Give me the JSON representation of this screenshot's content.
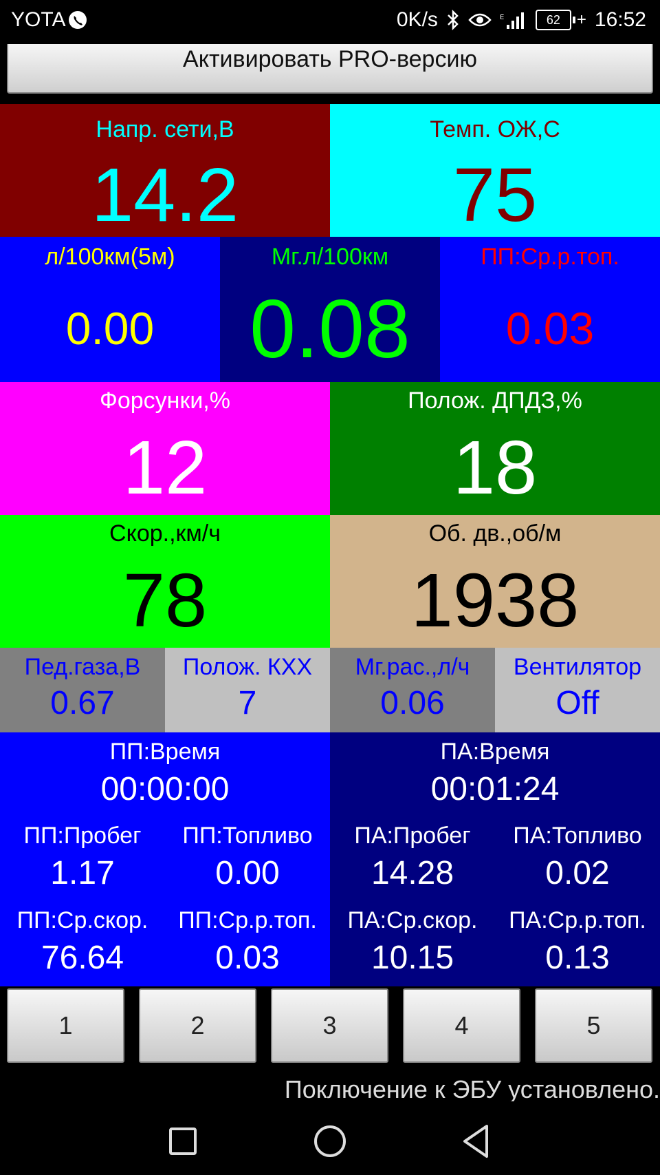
{
  "status_bar": {
    "carrier": "YOTA",
    "net_speed": "0K/s",
    "battery": "62",
    "time": "16:52"
  },
  "pro_button": "Активировать PRO-версию",
  "row1": [
    {
      "label": "Напр. сети,В",
      "value": "14.2"
    },
    {
      "label": "Темп. ОЖ,С",
      "value": "75"
    }
  ],
  "row2": [
    {
      "label": "л/100км(5м)",
      "value": "0.00"
    },
    {
      "label": "Мг.л/100км",
      "value": "0.08"
    },
    {
      "label": "ПП:Ср.р.топ.",
      "value": "0.03"
    }
  ],
  "row3": [
    {
      "label": "Форсунки,%",
      "value": "12"
    },
    {
      "label": "Полож. ДПДЗ,%",
      "value": "18"
    }
  ],
  "row4": [
    {
      "label": "Скор.,км/ч",
      "value": "78"
    },
    {
      "label": "Об. дв.,об/м",
      "value": "1938"
    }
  ],
  "row5": [
    {
      "label": "Пед.газа,В",
      "value": "0.67"
    },
    {
      "label": "Полож. КХХ",
      "value": "7"
    },
    {
      "label": "Мг.рас.,л/ч",
      "value": "0.06"
    },
    {
      "label": "Вентилятор",
      "value": "Off"
    }
  ],
  "trip_pp": {
    "time_label": "ПП:Время",
    "time_value": "00:00:00",
    "distance_label": "ПП:Пробег",
    "distance_value": "1.17",
    "fuel_label": "ПП:Топливо",
    "fuel_value": "0.00",
    "avg_speed_label": "ПП:Ср.скор.",
    "avg_speed_value": "76.64",
    "avg_fuel_label": "ПП:Ср.р.топ.",
    "avg_fuel_value": "0.03"
  },
  "trip_pa": {
    "time_label": "ПА:Время",
    "time_value": "00:01:24",
    "distance_label": "ПА:Пробег",
    "distance_value": "14.28",
    "fuel_label": "ПА:Топливо",
    "fuel_value": "0.02",
    "avg_speed_label": "ПА:Ср.скор.",
    "avg_speed_value": "10.15",
    "avg_fuel_label": "ПА:Ср.р.топ.",
    "avg_fuel_value": "0.13"
  },
  "page_buttons": [
    "1",
    "2",
    "3",
    "4",
    "5"
  ],
  "connection_status": "Поключение к ЭБУ установлено.",
  "colors": {
    "maroon": "#800000",
    "cyan": "#00ffff",
    "blue": "#0000ff",
    "navy": "#000080",
    "magenta": "#ff00ff",
    "green": "#008000",
    "lime": "#00ff00",
    "tan": "#d2b48c",
    "gray": "#808080",
    "silver": "#c0c0c0"
  }
}
